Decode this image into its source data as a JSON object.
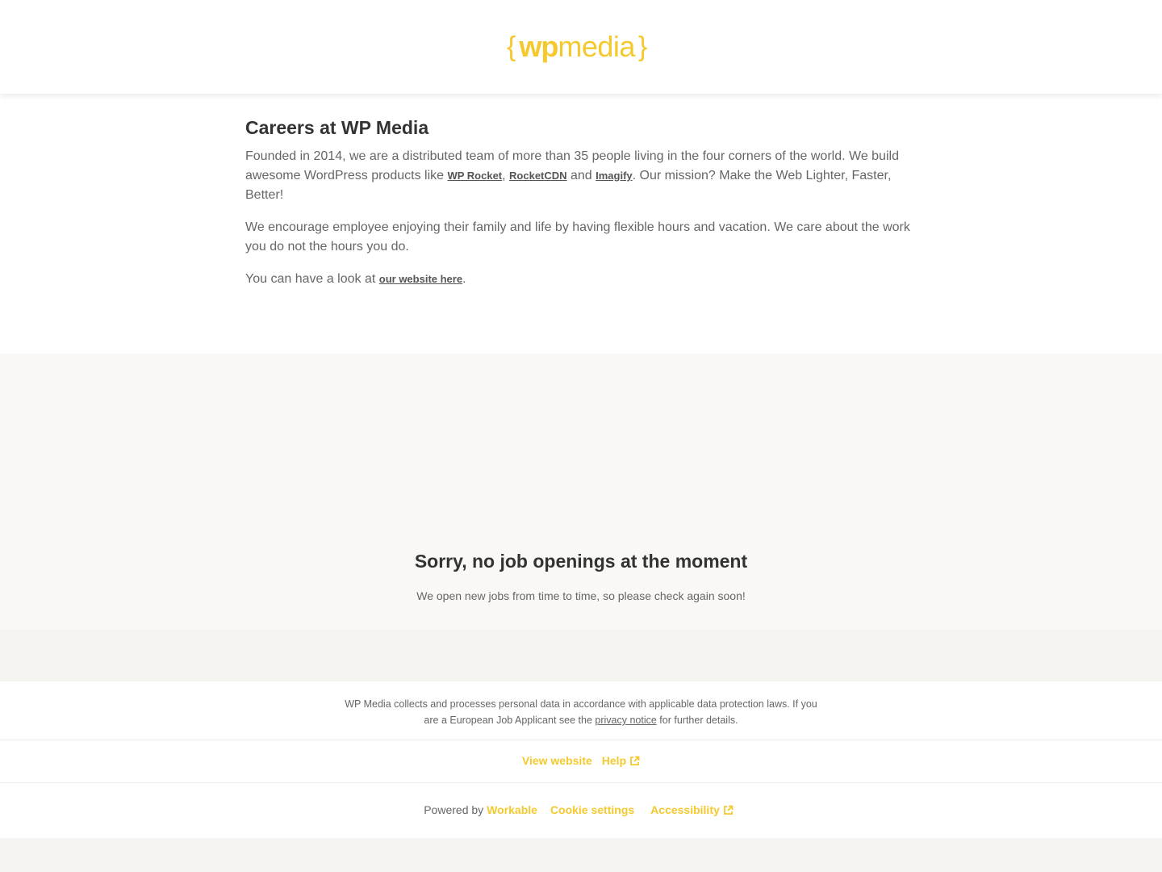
{
  "header": {
    "logo": {
      "left_brace": "{",
      "wp": "wp",
      "media": "media",
      "right_brace": "}",
      "color": "#f5c92e"
    }
  },
  "intro": {
    "title": "Careers at WP Media",
    "p1_before": "Founded in 2014, we are a distributed team of more than 35 people living in the four corners of the world. We build awesome WordPress products like ",
    "link_wp_rocket": "WP Rocket",
    "sep1": ", ",
    "link_rocketcdn": "RocketCDN",
    "sep2": " and ",
    "link_imagify": "Imagify",
    "p1_after": ". Our mission? Make the Web Lighter, Faster, Better!",
    "p2": "We encourage employee enjoying their family and life by having flexible hours and vacation. We care about the work you do not the hours you do.",
    "p3_before": "You can have a look at ",
    "link_website": "our website here",
    "p3_after": "."
  },
  "jobs": {
    "title": "Sorry, no job openings at the moment",
    "subtitle": "We open new jobs from time to time, so please check again soon!"
  },
  "footer": {
    "privacy_before": "WP Media collects and processes personal data in accordance with applicable data protection laws. If you are a European Job Applicant see the ",
    "privacy_link": "privacy notice",
    "privacy_after": " for further details.",
    "view_website": "View website",
    "help": "Help",
    "powered_by": "Powered by",
    "workable": "Workable",
    "cookie_settings": "Cookie settings",
    "accessibility": "Accessibility",
    "accent_color": "#f5c92e"
  }
}
